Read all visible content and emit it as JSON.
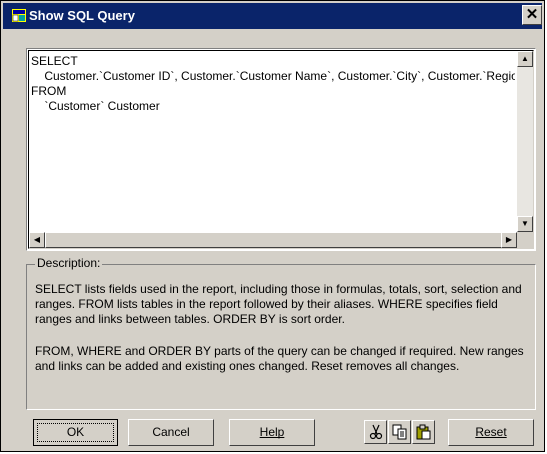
{
  "window": {
    "title": "Show SQL Query",
    "close_label": "✕"
  },
  "sql": {
    "lines": [
      "SELECT",
      "    Customer.`Customer ID`, Customer.`Customer Name`, Customer.`City`, Customer.`Region`",
      "FROM",
      "    `Customer` Customer"
    ]
  },
  "description": {
    "title": "Description:",
    "para1": "SELECT lists fields used in the report, including those in formulas, totals, sort, selection and ranges.  FROM lists tables in the report followed by their aliases.  WHERE specifies field ranges and links between tables.  ORDER BY is sort order.",
    "para2": "FROM, WHERE and ORDER BY parts of the query can be changed if required.  New ranges and links can be added and existing ones changed.  Reset removes all changes."
  },
  "buttons": {
    "ok": "OK",
    "cancel": "Cancel",
    "help": "Help",
    "reset": "Reset"
  },
  "icons": {
    "cut": "scissors-icon",
    "copy": "copy-icon",
    "paste": "paste-icon"
  }
}
